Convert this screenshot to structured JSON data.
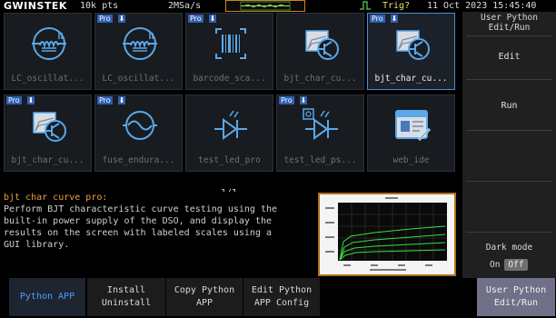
{
  "topbar": {
    "brand": "GWINSTEK",
    "points": "10k pts",
    "sample_rate": "2MSa/s",
    "trigger": "Trig?",
    "datetime": "11 Oct 2023 15:45:40"
  },
  "right_panel": {
    "title_line1": "User Python",
    "title_line2": "Edit/Run",
    "edit_label": "Edit",
    "run_label": "Run",
    "dark_mode_label": "Dark mode",
    "dark_on": "On",
    "dark_off": "Off"
  },
  "apps": [
    {
      "name": "LC_oscillat...",
      "pro": false,
      "icon": "lc-oscillator-icon",
      "selected": false
    },
    {
      "name": "LC_oscillat...",
      "pro": true,
      "icon": "lc-oscillator-icon",
      "selected": false
    },
    {
      "name": "barcode_sca...",
      "pro": true,
      "icon": "barcode-icon",
      "selected": false
    },
    {
      "name": "bjt_char_cu...",
      "pro": false,
      "icon": "bjt-curve-icon",
      "selected": false
    },
    {
      "name": "bjt_char_cu...",
      "pro": true,
      "icon": "bjt-curve-icon",
      "selected": true
    },
    {
      "name": "bjt_char_cu...",
      "pro": true,
      "icon": "bjt-curve-icon",
      "selected": false
    },
    {
      "name": "fuse_endura...",
      "pro": true,
      "icon": "fuse-icon",
      "selected": false
    },
    {
      "name": "test_led_pro",
      "pro": false,
      "icon": "led-icon",
      "selected": false
    },
    {
      "name": "test_led_ps...",
      "pro": true,
      "icon": "led-psu-icon",
      "selected": false
    },
    {
      "name": "web_ide",
      "pro": false,
      "icon": "web-ide-icon",
      "selected": false
    }
  ],
  "badges": {
    "pro": "Pro",
    "download": "⬇"
  },
  "page_indicator": "- 1/1 -",
  "description": {
    "title": "bjt char curve pro:",
    "body": "Perform BJT characteristic curve testing using the\nbuilt-in power supply of the DSO, and display the\nresults on the screen with labeled scales using a\nGUI library."
  },
  "bottom_keys": {
    "python_app": "Python APP",
    "install_1": "Install",
    "install_2": "Uninstall",
    "copy_1": "Copy Python",
    "copy_2": "APP",
    "edit_1": "Edit Python",
    "edit_2": "APP Config",
    "user_1": "User Python",
    "user_2": "Edit/Run"
  },
  "colors": {
    "accent_blue": "#4aa0ff",
    "icon_blue": "#5aa8e8",
    "description_title": "#e8a040",
    "trigger_text": "#e8e070",
    "preview_border": "#b07020"
  }
}
